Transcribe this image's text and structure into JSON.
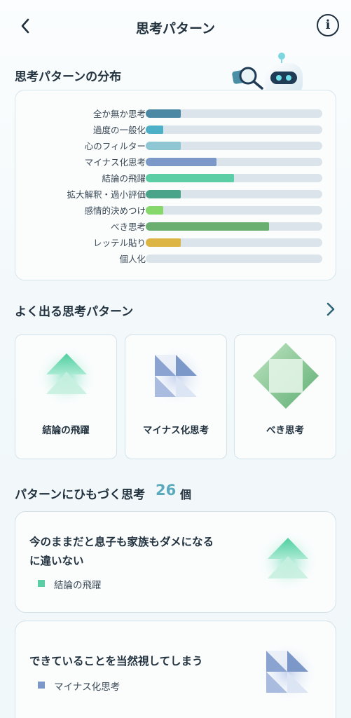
{
  "header": {
    "title": "思考パターン"
  },
  "distribution": {
    "title": "思考パターンの分布",
    "bars": [
      {
        "label": "全か無か思考",
        "value": 0.2,
        "color": "#4a88a3"
      },
      {
        "label": "過度の一般化",
        "value": 0.1,
        "color": "#4db0c6"
      },
      {
        "label": "心のフィルター",
        "value": 0.2,
        "color": "#8fc6d3"
      },
      {
        "label": "マイナス化思考",
        "value": 0.4,
        "color": "#7b98c9"
      },
      {
        "label": "結論の飛躍",
        "value": 0.5,
        "color": "#5ccea6"
      },
      {
        "label": "拡大解釈・過小評価",
        "value": 0.2,
        "color": "#4aa489"
      },
      {
        "label": "感情的決めつけ",
        "value": 0.1,
        "color": "#86d86b"
      },
      {
        "label": "べき思考",
        "value": 0.7,
        "color": "#6aaf70"
      },
      {
        "label": "レッテル貼り",
        "value": 0.2,
        "color": "#dcb545"
      },
      {
        "label": "個人化",
        "value": 0.0,
        "color": "#cccccc"
      }
    ]
  },
  "frequent": {
    "title": "よく出る思考パターン",
    "items": [
      {
        "label": "結論の飛躍",
        "icon": "leap-conclusion-icon"
      },
      {
        "label": "マイナス化思考",
        "icon": "minimization-icon"
      },
      {
        "label": "べき思考",
        "icon": "should-thinking-icon"
      }
    ]
  },
  "thoughts": {
    "title": "パターンにひもづく思考",
    "count": "26",
    "unit": "個",
    "items": [
      {
        "line1": "今のままだと息子も家族もダメになる",
        "line2": "に違いない",
        "tag": "結論の飛躍",
        "tag_color": "#5ccea6"
      },
      {
        "line1": "できていることを当然視してしまう",
        "tag": "マイナス化思考",
        "tag_color": "#7b98c9"
      }
    ]
  }
}
